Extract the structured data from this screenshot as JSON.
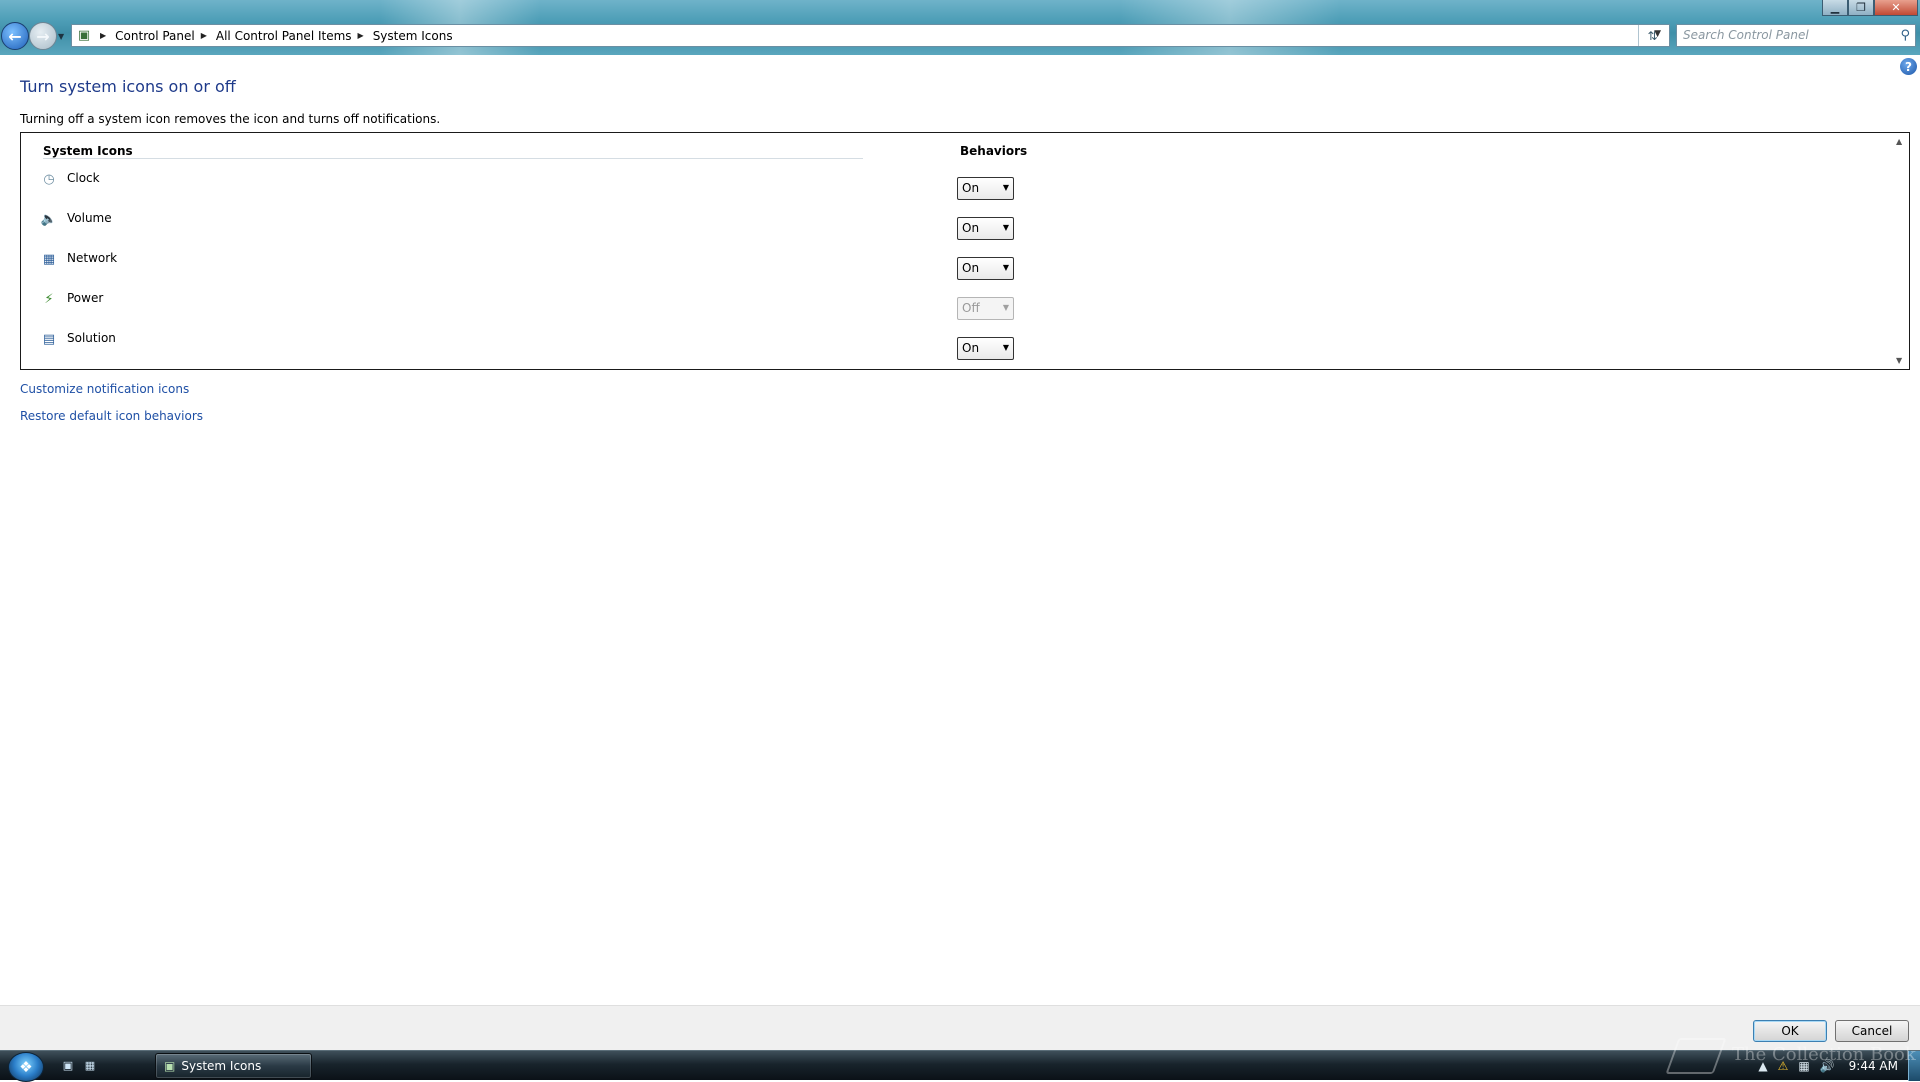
{
  "window": {
    "minimize_glyph": "▁",
    "restore_glyph": "❐",
    "close_glyph": "✕"
  },
  "address_bar": {
    "breadcrumbs": [
      "Control Panel",
      "All Control Panel Items",
      "System Icons"
    ],
    "icon": "control-panel-icon"
  },
  "search": {
    "placeholder": "Search Control Panel",
    "icon": "search-icon"
  },
  "page": {
    "title": "Turn system icons on or off",
    "description": "Turning off a system icon removes the icon and turns off notifications."
  },
  "table": {
    "col_icons": "System Icons",
    "col_behaviors": "Behaviors",
    "rows": [
      {
        "label": "Clock",
        "value": "On",
        "icon": "clock-icon",
        "disabled": false
      },
      {
        "label": "Volume",
        "value": "On",
        "icon": "volume-icon",
        "disabled": false
      },
      {
        "label": "Network",
        "value": "On",
        "icon": "network-icon",
        "disabled": false
      },
      {
        "label": "Power",
        "value": "Off",
        "icon": "power-icon",
        "disabled": true
      },
      {
        "label": "Solution",
        "value": "On",
        "icon": "solution-icon",
        "disabled": false
      }
    ]
  },
  "links": {
    "customize": "Customize notification icons",
    "restore": "Restore default icon behaviors"
  },
  "footer": {
    "ok": "OK",
    "cancel": "Cancel"
  },
  "taskbar": {
    "task_label": "System Icons",
    "clock": "9:44 AM",
    "watermark": "The Collection Book"
  }
}
